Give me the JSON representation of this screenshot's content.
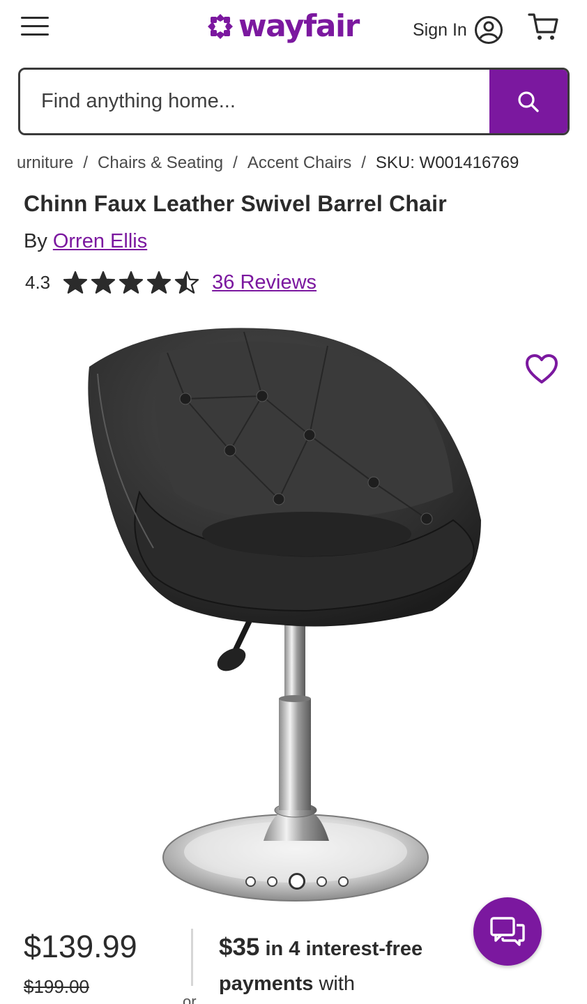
{
  "header": {
    "logo_text": "wayfair",
    "sign_in_label": "Sign In",
    "menu_icon": "hamburger-menu-icon",
    "account_icon": "user-circle-icon",
    "cart_icon": "shopping-cart-icon"
  },
  "search": {
    "placeholder": "Find anything home...",
    "value": "",
    "button_icon": "search-icon"
  },
  "breadcrumb": {
    "items": [
      "urniture",
      "Chairs & Seating",
      "Accent Chairs"
    ],
    "sku": "SKU: W001416769",
    "separator": "/"
  },
  "product": {
    "title": "Chinn Faux Leather Swivel Barrel Chair",
    "by_label": "By",
    "brand": "Orren Ellis",
    "rating": "4.3",
    "rating_value": 4.3,
    "rating_max": 5,
    "reviews_label": "36 Reviews",
    "image_alt": "black tufted faux leather swivel barrel chair on chrome pedestal base",
    "image_count": 5,
    "active_image": 3,
    "favorite_icon": "heart-outline-icon"
  },
  "pricing": {
    "price": "$139.99",
    "original_price": "$199.00",
    "or_label": "or",
    "installment_amount": "$35",
    "installment_bold": "in 4 interest-free",
    "installment_bold2": "payments",
    "installment_tail": "with"
  },
  "chat": {
    "icon": "chat-bubbles-icon"
  },
  "colors": {
    "brand": "#7b189f",
    "text": "#2b2b2b"
  }
}
